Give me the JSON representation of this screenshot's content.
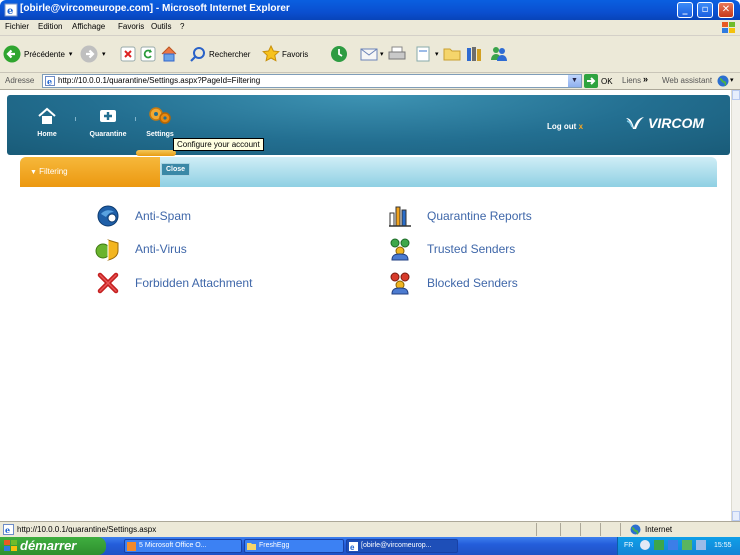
{
  "window": {
    "title": "[obirle@vircomeurope.com] - Microsoft Internet Explorer"
  },
  "menu": [
    "Fichier",
    "Edition",
    "Affichage",
    "Favoris",
    "Outils",
    "?"
  ],
  "toolbar": {
    "back_label": "Précédente",
    "search_label": "Rechercher",
    "favorites_label": "Favoris"
  },
  "address": {
    "label": "Adresse",
    "url": "http://10.0.0.1/quarantine/Settings.aspx?PageId=Filtering",
    "go_label": "OK",
    "links_label": "Liens",
    "links_chevron": "»",
    "web_assistant_label": "Web assistant"
  },
  "app": {
    "nav": [
      {
        "label": "Home",
        "icon": "home-icon"
      },
      {
        "label": "Quarantine",
        "icon": "quarantine-icon"
      },
      {
        "label": "Settings",
        "icon": "settings-icon"
      }
    ],
    "tooltip": "Configure your account",
    "logout_label": "Log out",
    "logout_mark": "x",
    "brand": "VIRCOM",
    "filter_tab": "Filtering",
    "close_label": "Close",
    "options_left": [
      {
        "label": "Anti-Spam",
        "icon": "anti-spam-icon"
      },
      {
        "label": "Anti-Virus",
        "icon": "anti-virus-icon"
      },
      {
        "label": "Forbidden Attachment",
        "icon": "forbidden-attachment-icon"
      }
    ],
    "options_right": [
      {
        "label": "Quarantine Reports",
        "icon": "bar-chart-icon"
      },
      {
        "label": "Trusted Senders",
        "icon": "trusted-senders-icon"
      },
      {
        "label": "Blocked Senders",
        "icon": "blocked-senders-icon"
      }
    ],
    "colors": {
      "header": "#236f91",
      "accent": "#ec9810",
      "link": "#3f67a9"
    }
  },
  "status": {
    "url": "http://10.0.0.1/quarantine/Settings.aspx",
    "zone": "Internet"
  },
  "taskbar": {
    "start_label": "démarrer",
    "tasks": [
      "5 Microsoft Office O...",
      "FreshEgg",
      "[obirle@vircomeurop..."
    ],
    "tray_lang": "FR",
    "time": "15:55"
  }
}
